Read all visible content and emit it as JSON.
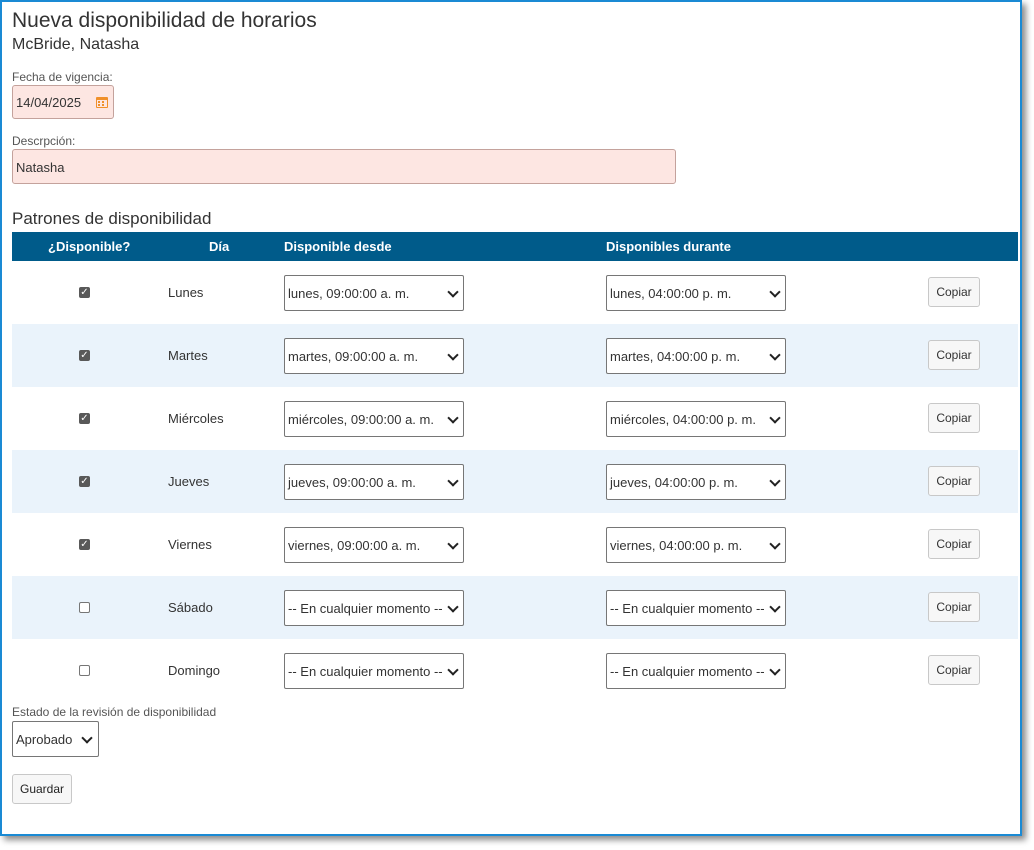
{
  "header": {
    "title": "Nueva disponibilidad de horarios",
    "employee": "McBride, Natasha"
  },
  "form": {
    "effective_date_label": "Fecha de vigencia:",
    "effective_date_value": "14/04/2025",
    "description_label": "Descrpción:",
    "description_value": "Natasha"
  },
  "patterns": {
    "title": "Patrones de disponibilidad",
    "columns": {
      "available": "¿Disponible?",
      "day": "Día",
      "from": "Disponible desde",
      "during": "Disponibles durante"
    },
    "rows": [
      {
        "available": true,
        "day": "Lunes",
        "from": "lunes, 09:00:00 a. m.",
        "during": "lunes, 04:00:00 p. m.",
        "copy": "Copiar"
      },
      {
        "available": true,
        "day": "Martes",
        "from": "martes, 09:00:00 a. m.",
        "during": "martes, 04:00:00 p. m.",
        "copy": "Copiar"
      },
      {
        "available": true,
        "day": "Miércoles",
        "from": "miércoles, 09:00:00 a. m.",
        "during": "miércoles, 04:00:00 p. m.",
        "copy": "Copiar"
      },
      {
        "available": true,
        "day": "Jueves",
        "from": "jueves, 09:00:00 a. m.",
        "during": "jueves, 04:00:00 p. m.",
        "copy": "Copiar"
      },
      {
        "available": true,
        "day": "Viernes",
        "from": "viernes, 09:00:00 a. m.",
        "during": "viernes, 04:00:00 p. m.",
        "copy": "Copiar"
      },
      {
        "available": false,
        "day": "Sábado",
        "from": "-- En cualquier momento --",
        "during": "-- En cualquier momento --",
        "copy": "Copiar"
      },
      {
        "available": false,
        "day": "Domingo",
        "from": "-- En cualquier momento --",
        "during": "-- En cualquier momento --",
        "copy": "Copiar"
      }
    ]
  },
  "review": {
    "label": "Estado de la revisión de disponibilidad",
    "value": "Aprobado"
  },
  "actions": {
    "save_label": "Guardar"
  },
  "colors": {
    "header_bg": "#005b8a",
    "alt_row_bg": "#eaf3fb",
    "required_field_bg": "#fde6e2",
    "frame_border": "#1a8ad4",
    "calendar_icon": "#f0902a"
  },
  "icons": {
    "date_picker": "calendar-icon",
    "select": "chevron-down-icon",
    "checked": "checkmark"
  }
}
